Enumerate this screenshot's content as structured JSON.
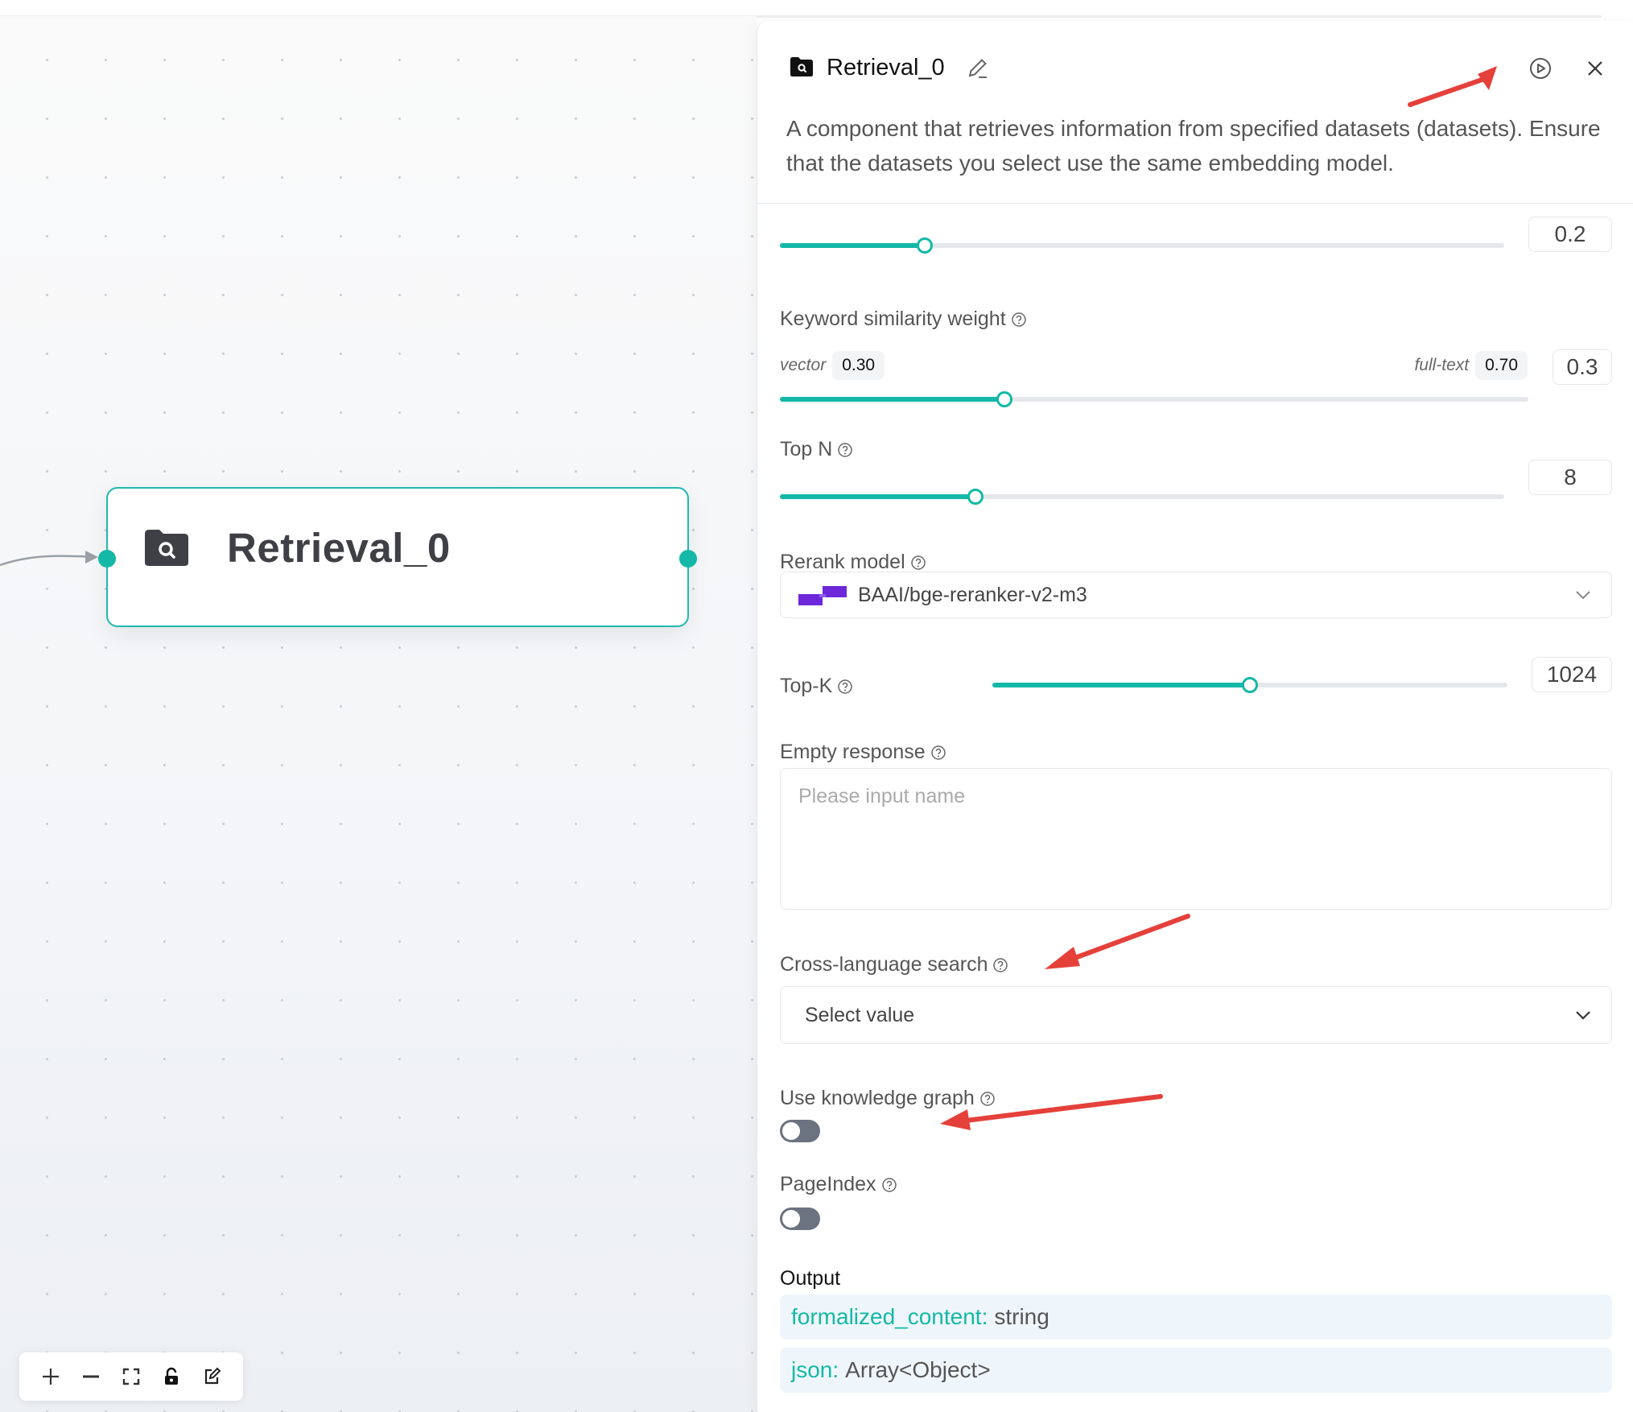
{
  "canvas": {
    "node": {
      "title": "Retrieval_0"
    },
    "controls": [
      "zoom-in",
      "zoom-out",
      "fit-view",
      "lock",
      "edit-note"
    ]
  },
  "panel": {
    "title": "Retrieval_0",
    "description": "A component that retrieves information from specified datasets (datasets). Ensure that the datasets you select use the same embedding model.",
    "similarity_threshold": {
      "value": "0.2",
      "fraction": 0.2
    },
    "keyword_weight": {
      "label": "Keyword similarity weight",
      "vector_label": "vector",
      "vector_value": "0.30",
      "fulltext_label": "full-text",
      "fulltext_value": "0.70",
      "value": "0.3",
      "fraction": 0.3
    },
    "top_n": {
      "label": "Top N",
      "value": "8",
      "fraction": 0.27
    },
    "rerank": {
      "label": "Rerank model",
      "value": "BAAI/bge-reranker-v2-m3"
    },
    "top_k": {
      "label": "Top-K",
      "value": "1024",
      "fraction": 0.5
    },
    "empty_response": {
      "label": "Empty response",
      "placeholder": "Please input name"
    },
    "cross_language": {
      "label": "Cross-language search",
      "placeholder": "Select value"
    },
    "knowledge_graph": {
      "label": "Use knowledge graph",
      "enabled": false
    },
    "page_index": {
      "label": "PageIndex",
      "enabled": false
    },
    "output": {
      "label": "Output",
      "items": [
        {
          "key": "formalized_content:",
          "type": "string"
        },
        {
          "key": "json:",
          "type": "Array<Object>"
        }
      ]
    }
  },
  "colors": {
    "accent": "#14b8a6",
    "annotation": "#e5403a",
    "rerank_logo": "#6d28d9"
  }
}
